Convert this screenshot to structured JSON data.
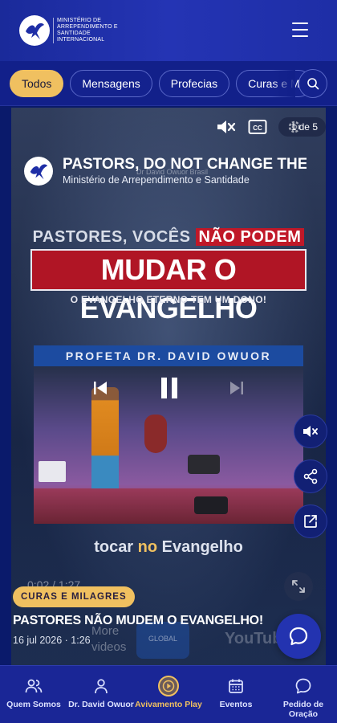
{
  "header": {
    "logo_text": "Ministério de Arrependimento e Santidade Internacional"
  },
  "filters": {
    "chips": [
      "Todos",
      "Mensagens",
      "Profecias",
      "Curas e M"
    ],
    "active": "Todos"
  },
  "player": {
    "counter": "1 de 5",
    "channel_title": "PASTORS, DO NOT CHANGE THE GOS",
    "channel_subtitle": "Ministério de Arrependimento e Santidade",
    "watermark": "Dr David Owuor Brasil",
    "time": "0:02 / 1:27",
    "more_videos": "More videos"
  },
  "thumbnail": {
    "line1_prefix": "PASTORES, VOCÊS",
    "line1_highlight": "NÃO PODEM",
    "line2": "MUDAR O EVANGELHO",
    "line3": "O EVANGELHO ETERNO TEM UM DONO!",
    "banner": "PROFETA DR. DAVID OWUOR",
    "bottom_prefix": "tocar",
    "bottom_highlight": "no",
    "bottom_suffix": "Evangelho",
    "youtube_text": "YouTube",
    "globo_text": "GLOBAL"
  },
  "video_info": {
    "tag": "CURAS E MILAGRES",
    "title": "PASTORES NÃO MUDEM O EVANGELHO!",
    "meta": "16 jul 2026 · 1:26"
  },
  "nav": {
    "items": [
      {
        "label": "Quem Somos",
        "icon": "people-icon"
      },
      {
        "label": "Dr. David Owuor",
        "icon": "person-icon"
      },
      {
        "label": "Avivamento Play",
        "icon": "play-circle-icon"
      },
      {
        "label": "Eventos",
        "icon": "calendar-icon"
      },
      {
        "label": "Pedido de Oração",
        "icon": "chat-bubble-icon"
      }
    ],
    "active": "Avivamento Play"
  },
  "colors": {
    "header_bg": "#2434b4",
    "accent": "#f0c060",
    "nav_bg": "#1a2696",
    "title_red": "#b01525"
  }
}
